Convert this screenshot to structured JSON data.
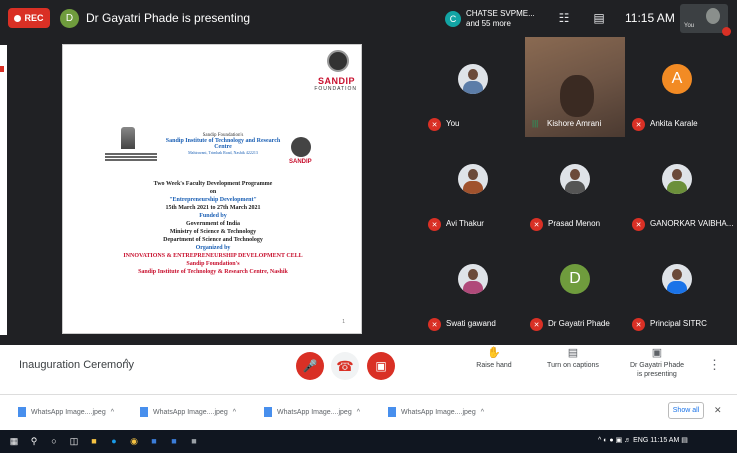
{
  "topbar": {
    "rec_label": "REC",
    "presenter_initial": "D",
    "presenting_text": "Dr Gayatri Phade is presenting",
    "participants_initial": "C",
    "participants_line1": "CHATSE SVPME...",
    "participants_line2": "and 55 more",
    "time": "11:15 AM",
    "self_label": "You"
  },
  "document": {
    "brand": "SANDIP",
    "brand_sub": "FOUNDATION",
    "org_small": "Sandip Foundation's",
    "institute": "Sandip Institute of Technology and Research Centre",
    "address": "Mahiravani, Trimbak Road, Nashik 422213",
    "emblem_caption": "Government of India / Department of Science and Technology",
    "seal2_text": "SANDIP",
    "programme": "Two Week's Faculty Development Programme",
    "on": "on",
    "topic": "\"Entrepreneurship Development\"",
    "dates": "15th March 2021 to 27th March 2021",
    "funded_by": "Funded by",
    "gov": "Government of India",
    "ministry": "Ministry of Science & Technology",
    "department": "Department of Science and Technology",
    "organized_by": "Organized by",
    "cell": "INNOVATIONS & ENTREPRENEURSHIP DEVELOPMENT CELL",
    "foundation": "Sandip Foundation's",
    "institute_full": "Sandip Institute of Technology & Research Centre, Nashik",
    "page_no": "1"
  },
  "tiles": [
    {
      "name": "You",
      "type": "photo",
      "color": "#5c7da8"
    },
    {
      "name": "Kishore Amrani",
      "type": "video"
    },
    {
      "name": "Ankita Karale",
      "type": "initial",
      "initial": "A",
      "color": "#f28b24"
    },
    {
      "name": "Avi Thakur",
      "type": "photo",
      "color": "#a0522d"
    },
    {
      "name": "Prasad Menon",
      "type": "photo",
      "color": "#555555"
    },
    {
      "name": "GANORKAR VAIBHA...",
      "type": "photo",
      "color": "#6b8f3a"
    },
    {
      "name": "Swati gawand",
      "type": "photo",
      "color": "#b04a7a"
    },
    {
      "name": "Dr Gayatri Phade",
      "type": "initial",
      "initial": "D",
      "color": "#6f9c3d"
    },
    {
      "name": "Principal SITRC",
      "type": "photo",
      "color": "#1a73e8"
    }
  ],
  "controls": {
    "meeting_title": "Inauguration Ceremony",
    "raise_hand": "Raise hand",
    "captions": "Turn on captions",
    "presenter_line1": "Dr Gayatri Phade",
    "presenter_line2": "is presenting"
  },
  "downloads": {
    "items": [
      "WhatsApp Image....jpeg",
      "WhatsApp Image....jpeg",
      "WhatsApp Image....jpeg",
      "WhatsApp Image....jpeg"
    ],
    "show_all": "Show all"
  },
  "taskbar": {
    "tray_text": "ENG",
    "time": "11:15 AM"
  }
}
